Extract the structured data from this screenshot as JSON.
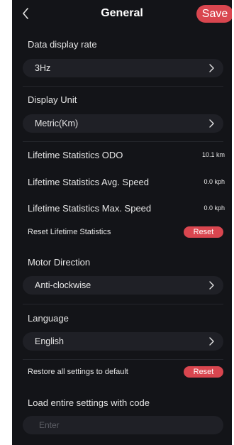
{
  "header": {
    "back_icon": "chevron-left-icon",
    "title": "General",
    "save_label": "Save"
  },
  "colors": {
    "background": "#131418",
    "field_background": "#1f2026",
    "accent": "#d9464f",
    "text": "#e6e6e6",
    "placeholder": "#5d5f66"
  },
  "data_display_rate": {
    "label": "Data display rate",
    "value": "3Hz",
    "icon": "chevron-right-icon"
  },
  "display_unit": {
    "label": "Display Unit",
    "value": "Metric(Km)",
    "icon": "chevron-right-icon"
  },
  "stats": [
    {
      "label": "Lifetime Statistics ODO",
      "value": "10.1 km"
    },
    {
      "label": "Lifetime Statistics Avg. Speed",
      "value": "0.0 kph"
    },
    {
      "label": "Lifetime Statistics Max. Speed",
      "value": "0.0 kph"
    }
  ],
  "reset_lifetime": {
    "label": "Reset Lifetime Statistics",
    "button_label": "Reset"
  },
  "motor_direction": {
    "label": "Motor Direction",
    "value": "Anti-clockwise",
    "icon": "chevron-right-icon"
  },
  "language": {
    "label": "Language",
    "value": "English",
    "icon": "chevron-right-icon"
  },
  "restore_defaults": {
    "label": "Restore all settings to default",
    "button_label": "Reset"
  },
  "load_code": {
    "label": "Load entire settings with code",
    "placeholder": "Enter",
    "value": ""
  }
}
